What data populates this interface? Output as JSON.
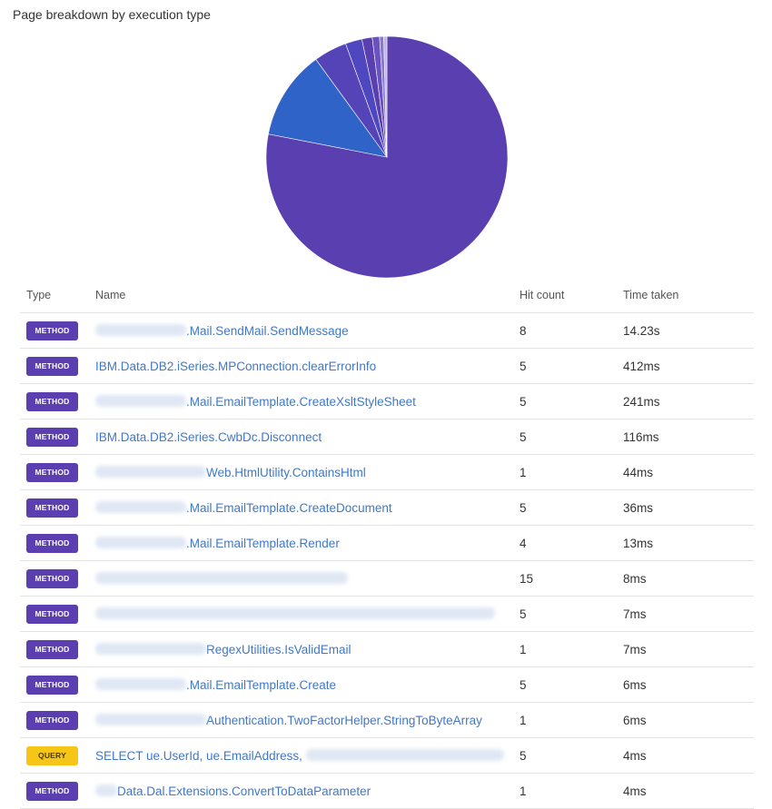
{
  "title": "Page breakdown by execution type",
  "colors": {
    "method_badge": "#5b3fb0",
    "query_badge": "#f5c518",
    "link": "#3f78c9",
    "pie_main": "#5a3fb0",
    "pie_secondary": "#2f63c8"
  },
  "table": {
    "headers": {
      "type": "Type",
      "name": "Name",
      "hits": "Hit count",
      "time": "Time taken"
    },
    "rows": [
      {
        "type": "METHOD",
        "name": ".Mail.SendMail.SendMessage",
        "hits": "8",
        "time": "14.23s"
      },
      {
        "type": "METHOD",
        "name": "IBM.Data.DB2.iSeries.MPConnection.clearErrorInfo",
        "hits": "5",
        "time": "412ms"
      },
      {
        "type": "METHOD",
        "name": ".Mail.EmailTemplate.CreateXsltStyleSheet",
        "hits": "5",
        "time": "241ms"
      },
      {
        "type": "METHOD",
        "name": "IBM.Data.DB2.iSeries.CwbDc.Disconnect",
        "hits": "5",
        "time": "116ms"
      },
      {
        "type": "METHOD",
        "name": "Web.HtmlUtility.ContainsHtml",
        "hits": "1",
        "time": "44ms"
      },
      {
        "type": "METHOD",
        "name": ".Mail.EmailTemplate.CreateDocument",
        "hits": "5",
        "time": "36ms"
      },
      {
        "type": "METHOD",
        "name": ".Mail.EmailTemplate.Render",
        "hits": "4",
        "time": "13ms"
      },
      {
        "type": "METHOD",
        "name": "",
        "hits": "15",
        "time": "8ms"
      },
      {
        "type": "METHOD",
        "name": "",
        "hits": "5",
        "time": "7ms"
      },
      {
        "type": "METHOD",
        "name": "RegexUtilities.IsValidEmail",
        "hits": "1",
        "time": "7ms"
      },
      {
        "type": "METHOD",
        "name": ".Mail.EmailTemplate.Create",
        "hits": "5",
        "time": "6ms"
      },
      {
        "type": "METHOD",
        "name": "Authentication.TwoFactorHelper.StringToByteArray",
        "hits": "1",
        "time": "6ms"
      },
      {
        "type": "QUERY",
        "name": "SELECT ue.UserId, ue.EmailAddress,",
        "hits": "5",
        "time": "4ms"
      },
      {
        "type": "METHOD",
        "name": "Data.Dal.Extensions.ConvertToDataParameter",
        "hits": "1",
        "time": "4ms"
      }
    ]
  }
}
